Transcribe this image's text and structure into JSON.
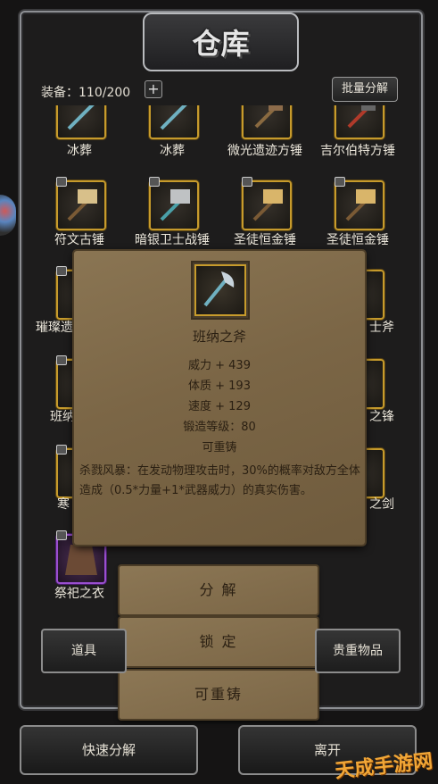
{
  "window": {
    "title": "仓库"
  },
  "topbar": {
    "equip_label": "装备：110/200",
    "plus": "+",
    "batch_decompose": "批量分解"
  },
  "items": [
    {
      "label": "冰葬",
      "icon": "spear-icon"
    },
    {
      "label": "冰葬",
      "icon": "spear-icon"
    },
    {
      "label": "微光遗迹方锤",
      "icon": "hammer-icon"
    },
    {
      "label": "吉尔伯特方锤",
      "icon": "hammer-icon"
    },
    {
      "label": "符文古锤",
      "icon": "hammer-icon"
    },
    {
      "label": "暗银卫士战锤",
      "icon": "hammer-icon"
    },
    {
      "label": "圣徒恒金锤",
      "icon": "hammer-icon"
    },
    {
      "label": "圣徒恒金锤",
      "icon": "hammer-icon"
    },
    {
      "label": "璀璨遗",
      "icon": "axe-icon"
    },
    {
      "label": "士斧",
      "icon": "axe-icon"
    },
    {
      "label": "班纳",
      "icon": "axe-icon"
    },
    {
      "label": "之锋",
      "icon": "blade-icon"
    },
    {
      "label": "寒",
      "icon": "sword-icon"
    },
    {
      "label": "之剑",
      "icon": "sword-icon"
    },
    {
      "label": "祭祀之衣",
      "icon": "robe-icon"
    }
  ],
  "popup": {
    "name": "班纳之斧",
    "stats": [
      "威力 + 439",
      "体质 + 193",
      "速度 + 129",
      "锻造等级：80",
      "可重铸"
    ],
    "description": "杀戮风暴：在发动物理攻击时，30%的概率对敌方全体造成（0.5*力量+1*武器威力）的真实伤害。"
  },
  "actions": {
    "decompose": "分 解",
    "lock": "锁 定",
    "reforge": "可重铸"
  },
  "tabs": {
    "props": "道具",
    "valuables": "贵重物品"
  },
  "bottom": {
    "quick_decompose": "快速分解",
    "leave": "离开"
  },
  "watermark": "天成手游网",
  "colors": {
    "gold_border": "#c79b2c",
    "purple_border": "#9a4fd0",
    "parchment": "#7b6646"
  }
}
